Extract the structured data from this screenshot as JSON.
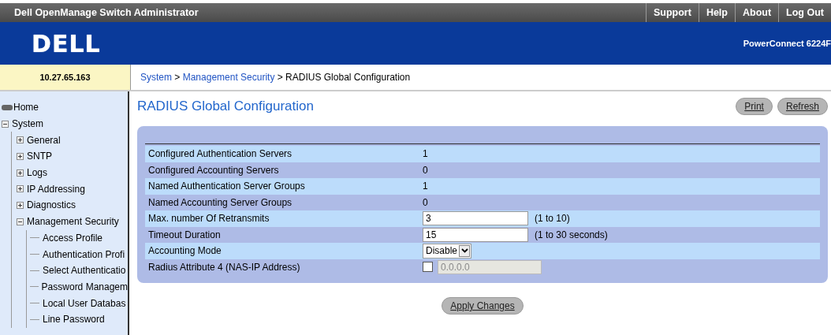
{
  "header": {
    "title": "Dell OpenManage Switch Administrator",
    "links": [
      "Support",
      "Help",
      "About",
      "Log Out"
    ],
    "model": "PowerConnect 6224F"
  },
  "logo": {
    "text": "DELL"
  },
  "ip_address": "10.27.65.163",
  "breadcrumb": [
    {
      "label": "System",
      "link": true
    },
    {
      "label": " > ",
      "link": false
    },
    {
      "label": "Management Security",
      "link": true
    },
    {
      "label": " > RADIUS Global Configuration",
      "link": false
    }
  ],
  "sidebar": {
    "items": [
      {
        "label": "Home",
        "kind": "home"
      },
      {
        "label": "System",
        "kind": "folder",
        "expanded": true,
        "children": [
          {
            "label": "General",
            "kind": "folder",
            "expanded": false
          },
          {
            "label": "SNTP",
            "kind": "folder",
            "expanded": false
          },
          {
            "label": "Logs",
            "kind": "folder",
            "expanded": false
          },
          {
            "label": "IP Addressing",
            "kind": "folder",
            "expanded": false
          },
          {
            "label": "Diagnostics",
            "kind": "folder",
            "expanded": false
          },
          {
            "label": "Management Security",
            "kind": "folder",
            "expanded": true,
            "children": [
              {
                "label": "Access Profile",
                "kind": "leaf"
              },
              {
                "label": "Authentication Profi",
                "kind": "leaf"
              },
              {
                "label": "Select Authenticatio",
                "kind": "leaf"
              },
              {
                "label": "Password Managem",
                "kind": "leaf"
              },
              {
                "label": "Local User Databas",
                "kind": "leaf"
              },
              {
                "label": "Line Password",
                "kind": "leaf"
              }
            ]
          }
        ]
      }
    ]
  },
  "page": {
    "title": "RADIUS Global Configuration",
    "buttons": [
      "Print",
      "Refresh"
    ]
  },
  "table": {
    "rows": [
      {
        "label": "Configured Authentication Servers",
        "kind": "text",
        "value": "1"
      },
      {
        "label": "Configured Accounting Servers",
        "kind": "text",
        "value": "0"
      },
      {
        "label": "Named Authentication Server Groups",
        "kind": "text",
        "value": "1"
      },
      {
        "label": "Named Accounting Server Groups",
        "kind": "text",
        "value": "0"
      },
      {
        "label": "Max. number Of Retransmits",
        "kind": "input",
        "value": "3",
        "hint": "(1 to 10)"
      },
      {
        "label": "Timeout Duration",
        "kind": "input",
        "value": "15",
        "hint": "(1 to 30 seconds)"
      },
      {
        "label": "Accounting Mode",
        "kind": "select",
        "value": "Disable"
      },
      {
        "label": "Radius Attribute 4 (NAS-IP Address)",
        "kind": "checkinput",
        "checked": false,
        "placeholder": "0.0.0.0",
        "disabled": true
      }
    ]
  },
  "apply_button": "Apply Changes"
}
